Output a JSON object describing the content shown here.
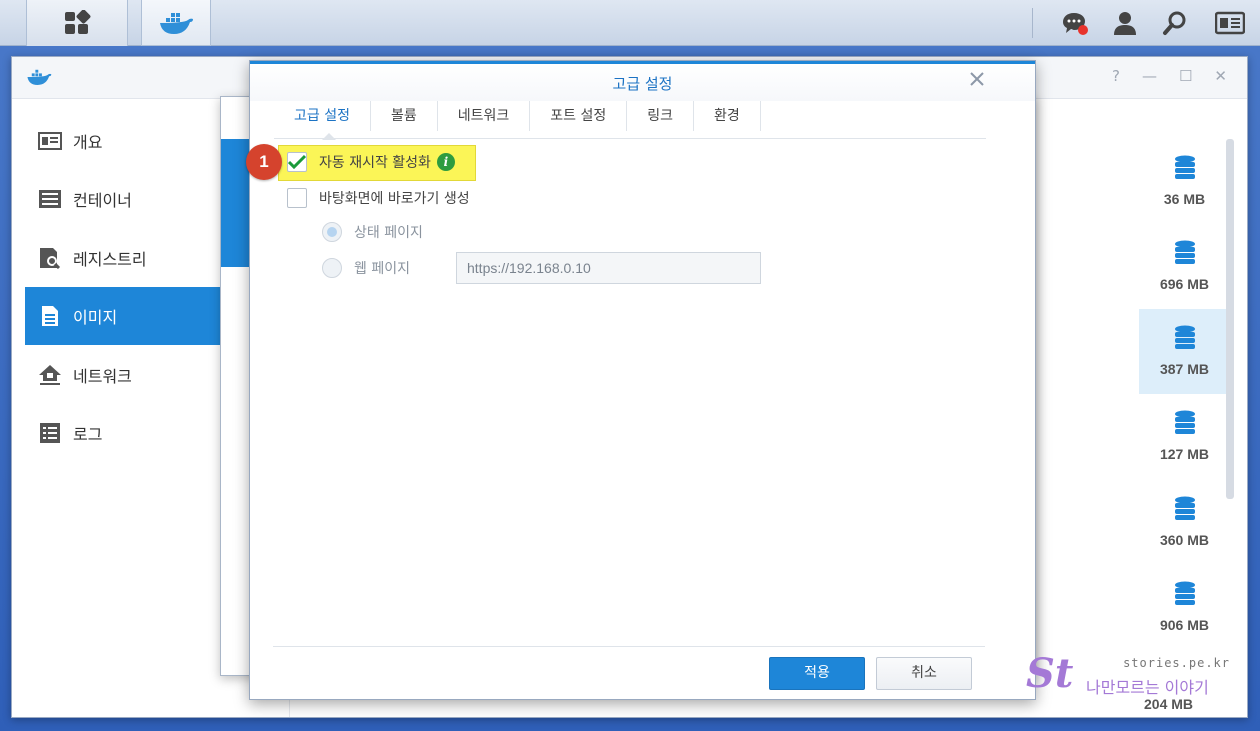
{
  "sidebar": {
    "items": [
      {
        "label": "개요"
      },
      {
        "label": "컨테이너"
      },
      {
        "label": "레지스트리"
      },
      {
        "label": "이미지"
      },
      {
        "label": "네트워크"
      },
      {
        "label": "로그"
      }
    ]
  },
  "image_sizes": [
    "36 MB",
    "696 MB",
    "387 MB",
    "127 MB",
    "360 MB",
    "906 MB",
    "204 MB"
  ],
  "dialog": {
    "title": "고급 설정",
    "tabs": [
      "고급 설정",
      "볼륨",
      "네트워크",
      "포트 설정",
      "링크",
      "환경"
    ],
    "options": {
      "auto_restart": "자동 재시작 활성화",
      "desktop_shortcut": "바탕화면에 바로가기 생성",
      "status_page": "상태 페이지",
      "web_page": "웹 페이지",
      "url_value": "https://192.168.0.10"
    },
    "apply_label": "적용",
    "cancel_label": "취소"
  },
  "annotation": {
    "step": "1"
  },
  "watermark": {
    "logo": "St",
    "site": "stories.pe.kr",
    "tagline": "나만모르는 이야기"
  },
  "colors": {
    "accent": "#1e86d8",
    "highlight": "#fbf557",
    "badge": "#d5432d"
  }
}
